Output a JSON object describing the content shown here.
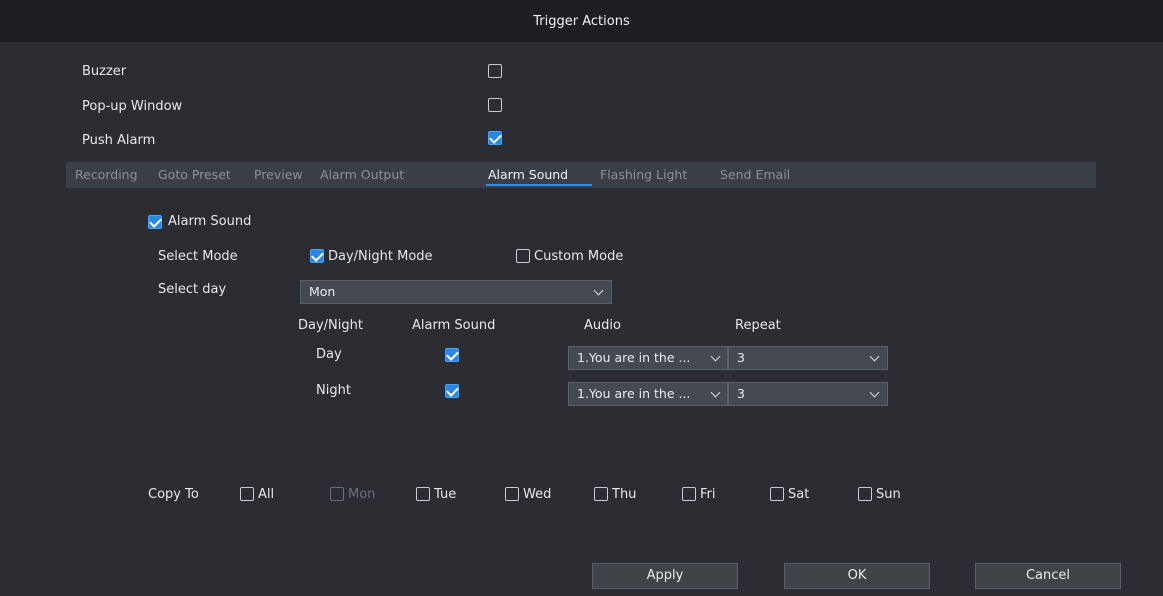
{
  "dialog": {
    "title": "Trigger Actions"
  },
  "options": [
    {
      "label": "Buzzer",
      "checked": false
    },
    {
      "label": "Pop-up Window",
      "checked": false
    },
    {
      "label": "Push Alarm",
      "checked": true
    }
  ],
  "tabs": [
    {
      "label": "Recording",
      "active": false
    },
    {
      "label": "Goto Preset",
      "active": false
    },
    {
      "label": "Preview",
      "active": false
    },
    {
      "label": "Alarm Output",
      "active": false
    },
    {
      "label": "Alarm Sound",
      "active": true
    },
    {
      "label": "Flashing Light",
      "active": false
    },
    {
      "label": "Send Email",
      "active": false
    }
  ],
  "alarm_sound": {
    "enable_label": "Alarm Sound",
    "enabled": true,
    "select_mode_label": "Select Mode",
    "mode_daynight": "Day/Night Mode",
    "mode_custom": "Custom Mode",
    "select_day_label": "Select day",
    "selected_day": "Mon",
    "table_headers": [
      "Day/Night",
      "Alarm Sound",
      "Audio",
      "Repeat"
    ],
    "rows": [
      {
        "period": "Day",
        "sound_on": true,
        "audio": "1.You are in the ...",
        "repeat": "3"
      },
      {
        "period": "Night",
        "sound_on": true,
        "audio": "1.You are in the ...",
        "repeat": "3"
      }
    ]
  },
  "copy_to": {
    "label": "Copy To",
    "items": [
      "All",
      "Mon",
      "Tue",
      "Wed",
      "Thu",
      "Fri",
      "Sat",
      "Sun"
    ]
  },
  "buttons": {
    "apply": "Apply",
    "ok": "OK",
    "cancel": "Cancel"
  }
}
